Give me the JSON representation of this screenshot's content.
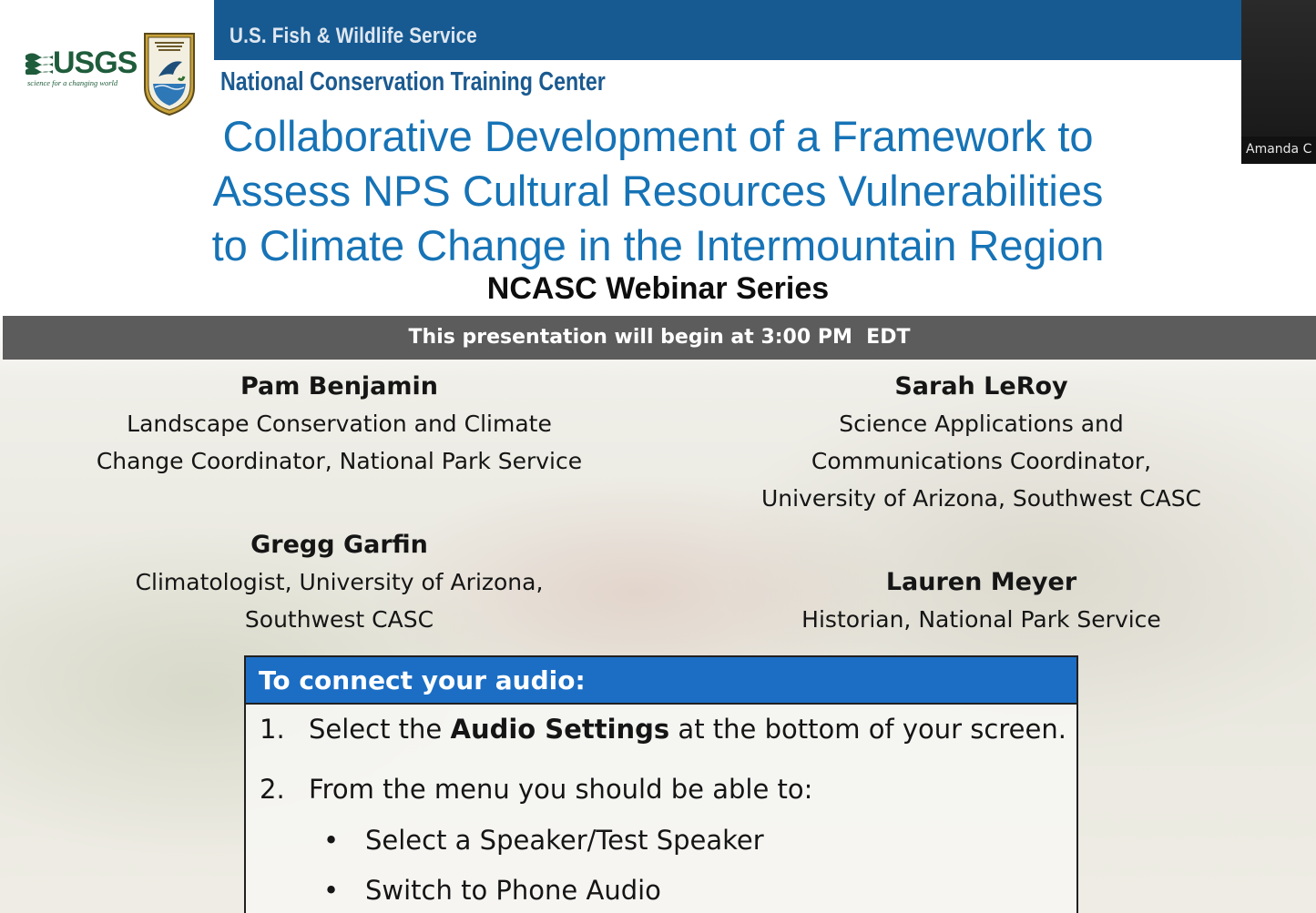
{
  "header": {
    "agency": "U.S. Fish & Wildlife Service",
    "center": "National Conservation Training Center",
    "usgs_logo_text": "USGS",
    "usgs_tagline": "science for a changing world"
  },
  "slide": {
    "title_lines": [
      "Collaborative Development of a Framework to",
      "Assess NPS Cultural Resources Vulnerabilities",
      "to Climate Change in the Intermountain Region"
    ],
    "series": "NCASC Webinar Series",
    "start_notice": "This presentation will begin at 3:00 PM  EDT"
  },
  "speakers": [
    {
      "name": "Pam Benjamin",
      "role_lines": [
        "Landscape Conservation and Climate",
        "Change Coordinator, National Park Service"
      ]
    },
    {
      "name": "Sarah LeRoy",
      "role_lines": [
        "Science Applications and",
        "Communications Coordinator,",
        "University of Arizona, Southwest CASC"
      ]
    },
    {
      "name": "Gregg Garfin",
      "role_lines": [
        "Climatologist, University of Arizona,",
        "Southwest CASC"
      ]
    },
    {
      "name": "Lauren Meyer",
      "role_lines": [
        "Historian, National Park Service"
      ]
    }
  ],
  "audio": {
    "heading": "To connect your audio:",
    "step1": {
      "num": "1.",
      "before": "Select the ",
      "bold": "Audio Settings",
      "after": " at the bottom of your screen."
    },
    "step2": {
      "num": "2.",
      "text": "From the menu you should be able to:"
    },
    "bullets": [
      "Select a Speaker/Test Speaker",
      "Switch to Phone Audio"
    ],
    "bullet_char": "•"
  },
  "participant": {
    "name": "Amanda C"
  },
  "colors": {
    "header_blue": "#175a92",
    "title_blue": "#1673b6",
    "audio_blue": "#1c6ec4",
    "notice_gray": "#5c5c5c"
  }
}
